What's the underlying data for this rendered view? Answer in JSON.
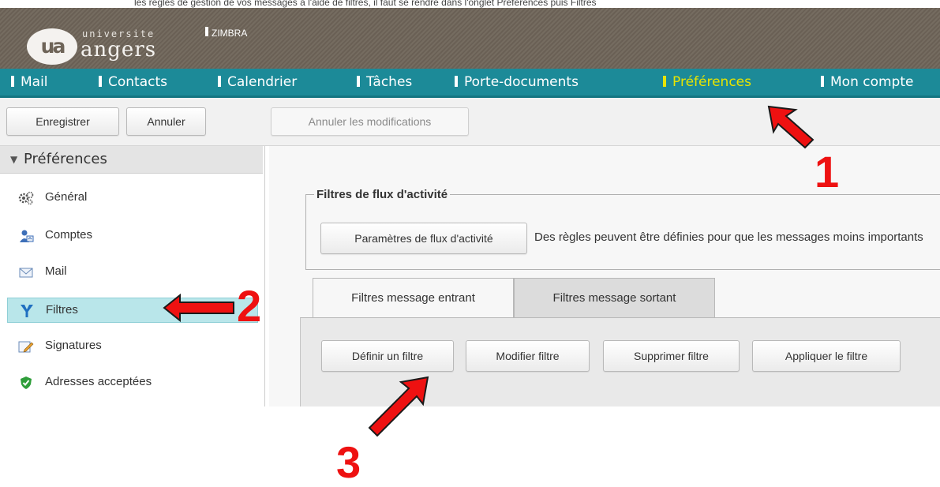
{
  "top_caption": "les règles de gestion de vos messages à l'aide de filtres, il faut se rendre dans l'onglet Préférences puis Filtres",
  "header": {
    "logo_badge": "ua",
    "logo_top": "universite",
    "logo_bottom": "angers",
    "app_name": "ZIMBRA"
  },
  "nav": {
    "items": [
      {
        "label": "Mail"
      },
      {
        "label": "Contacts"
      },
      {
        "label": "Calendrier"
      },
      {
        "label": "Tâches"
      },
      {
        "label": "Porte-documents"
      },
      {
        "label": "Préférences",
        "active": true
      },
      {
        "label": "Mon compte"
      }
    ]
  },
  "toolbar": {
    "save_label": "Enregistrer",
    "cancel_label": "Annuler",
    "revert_label": "Annuler les modifications"
  },
  "sidebar": {
    "header": "Préférences",
    "items": [
      {
        "label": "Général",
        "icon": "gear-icon"
      },
      {
        "label": "Comptes",
        "icon": "accounts-icon"
      },
      {
        "label": "Mail",
        "icon": "envelope-icon"
      },
      {
        "label": "Filtres",
        "icon": "filter-icon",
        "selected": true
      },
      {
        "label": "Signatures",
        "icon": "signature-icon"
      },
      {
        "label": "Adresses acceptées",
        "icon": "shield-check-icon"
      }
    ]
  },
  "activity_filters": {
    "legend": "Filtres de flux d'activité",
    "settings_button": "Paramètres de flux d'activité",
    "description": "Des règles peuvent être définies pour que les messages moins importants"
  },
  "tabs": [
    {
      "label": "Filtres message entrant",
      "active": true
    },
    {
      "label": "Filtres message sortant",
      "active": false
    }
  ],
  "filter_actions": {
    "define": "Définir un filtre",
    "modify": "Modifier filtre",
    "delete": "Supprimer filtre",
    "apply": "Appliquer le filtre"
  },
  "annotations": {
    "step1": "1",
    "step2": "2",
    "step3": "3",
    "color": "#ee1111"
  },
  "colors": {
    "header_bg": "#6e6458",
    "nav_bg": "#1c8a98",
    "nav_active": "#e8e400",
    "selected_bg": "#b9e6ea"
  }
}
